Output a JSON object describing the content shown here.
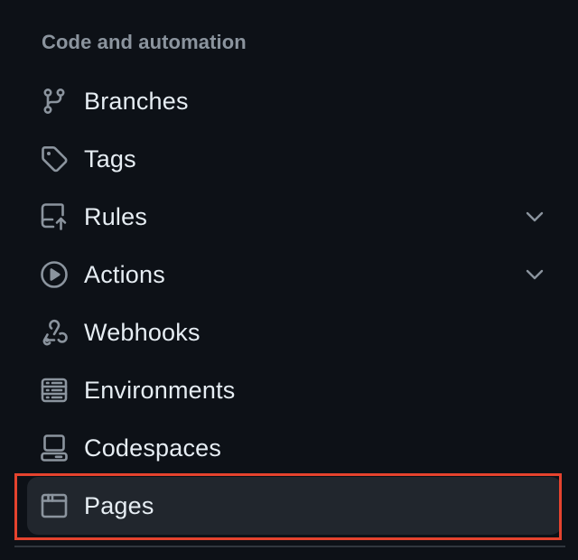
{
  "section": {
    "heading": "Code and automation"
  },
  "nav": {
    "items": [
      {
        "label": "Branches",
        "icon": "git-branch-icon",
        "expandable": false,
        "selected": false
      },
      {
        "label": "Tags",
        "icon": "tag-icon",
        "expandable": false,
        "selected": false
      },
      {
        "label": "Rules",
        "icon": "repo-push-icon",
        "expandable": true,
        "selected": false
      },
      {
        "label": "Actions",
        "icon": "play-icon",
        "expandable": true,
        "selected": false
      },
      {
        "label": "Webhooks",
        "icon": "webhook-icon",
        "expandable": false,
        "selected": false
      },
      {
        "label": "Environments",
        "icon": "server-icon",
        "expandable": false,
        "selected": false
      },
      {
        "label": "Codespaces",
        "icon": "codespaces-icon",
        "expandable": false,
        "selected": false
      },
      {
        "label": "Pages",
        "icon": "browser-icon",
        "expandable": false,
        "selected": true
      }
    ]
  },
  "colors": {
    "background": "#0d1117",
    "text": "#e6edf3",
    "muted": "#8b949e",
    "selected_bg": "#21262d",
    "highlight": "#e5432e"
  }
}
